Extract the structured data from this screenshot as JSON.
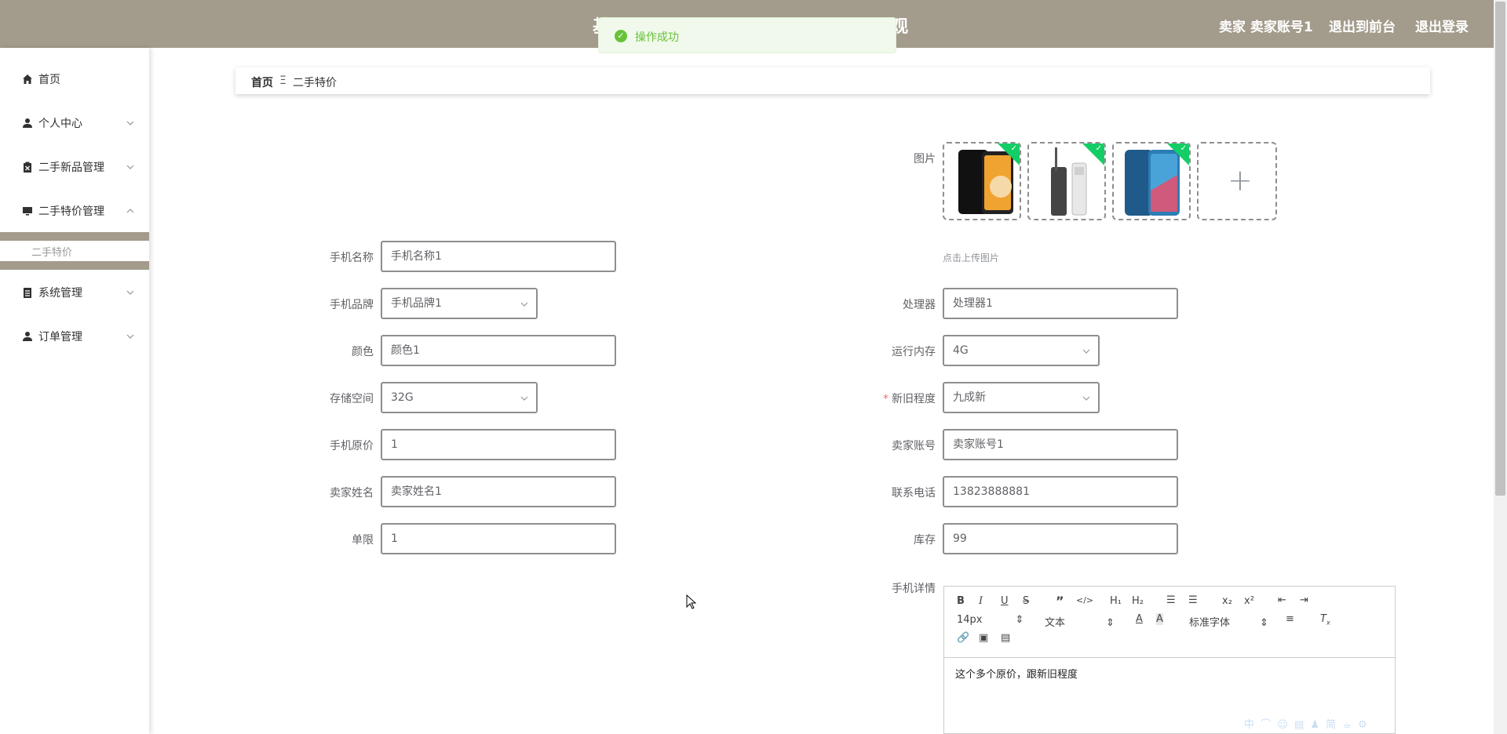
{
  "header": {
    "title_start": "基",
    "title_end": "观",
    "user_label": "卖家 卖家账号1",
    "to_front": "退出到前台",
    "logout": "退出登录",
    "bg_color": "#a39b8b"
  },
  "toast": {
    "message": "操作成功",
    "type": "success"
  },
  "sidebar": {
    "items": [
      {
        "label": "首页",
        "icon": "home-icon"
      },
      {
        "label": "个人中心",
        "icon": "user-icon"
      },
      {
        "label": "二手新品管理",
        "icon": "clipboard-icon"
      },
      {
        "label": "二手特价管理",
        "icon": "monitor-icon"
      },
      {
        "label": "系统管理",
        "icon": "list-icon"
      },
      {
        "label": "订单管理",
        "icon": "user-icon"
      }
    ],
    "sub_item": "二手特价"
  },
  "breadcrumb": {
    "home": "首页",
    "separator": "Ξ",
    "current": "二手特价"
  },
  "form": {
    "image_label": "图片",
    "upload_tip": "点击上传图片",
    "phone_name_label": "手机名称",
    "phone_name": "手机名称1",
    "brand_label": "手机品牌",
    "brand": "手机品牌1",
    "processor_label": "处理器",
    "processor": "处理器1",
    "color_label": "颜色",
    "color": "颜色1",
    "ram_label": "运行内存",
    "ram": "4G",
    "storage_label": "存储空间",
    "storage": "32G",
    "condition_label": "新旧程度",
    "condition": "九成新",
    "orig_price_label": "手机原价",
    "orig_price": "1",
    "seller_account_label": "卖家账号",
    "seller_account": "卖家账号1",
    "seller_name_label": "卖家姓名",
    "seller_name": "卖家姓名1",
    "phone_label": "联系电话",
    "phone": "13823888881",
    "limit_label": "单限",
    "limit": "1",
    "stock_label": "库存",
    "stock": "99",
    "detail_label": "手机详情"
  },
  "editor": {
    "font_size": "14px",
    "paragraph": "文本",
    "font_family": "标准字体",
    "content": "这个多个原价，跟新旧程度",
    "watermark": "中 ⌒ ☺ ▤ ♟ 简 ☕ ⚙"
  }
}
